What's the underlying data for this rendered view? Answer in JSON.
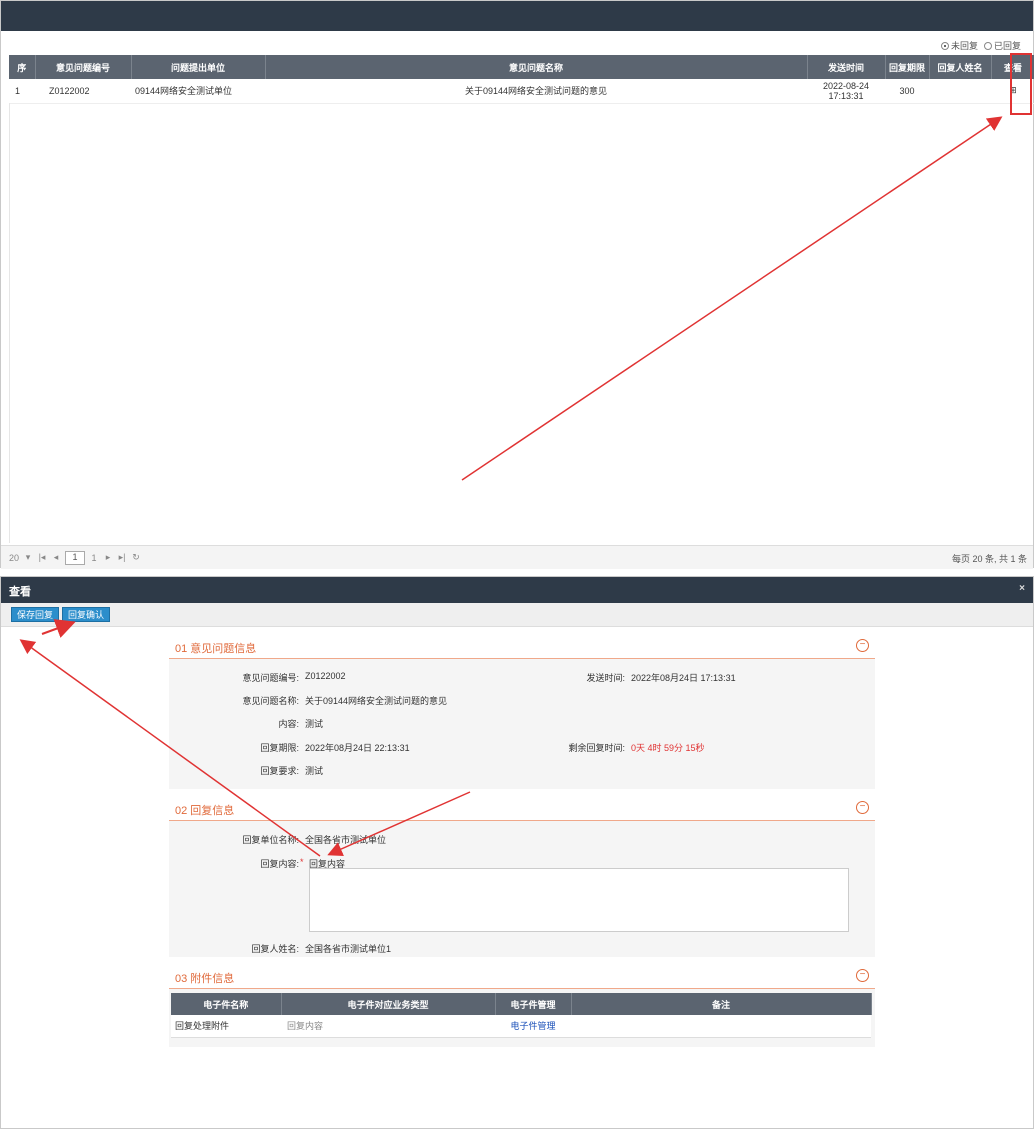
{
  "list_window": {
    "filter": {
      "options": [
        {
          "label": "未回复",
          "selected": true
        },
        {
          "label": "已回复",
          "selected": false
        }
      ]
    },
    "table": {
      "columns": [
        "序",
        "意见问题编号",
        "问题提出单位",
        "意见问题名称",
        "发送时间",
        "回复期限",
        "回复人姓名",
        "查看"
      ],
      "rows": [
        {
          "seq": "1",
          "id": "Z0122002",
          "unit": "09144网络安全测试单位",
          "name": "关于09144网络安全测试问题的意见",
          "time": "2022-08-24 17:13:31",
          "deadline": "300",
          "replier": "",
          "view": "⊞"
        }
      ]
    },
    "pager": {
      "page_size": "20",
      "page": "1",
      "total_pages": "1",
      "summary": "每页 20 条, 共 1 条"
    }
  },
  "detail_window": {
    "title": "查看",
    "close": "×",
    "toolbar": {
      "save_label": "保存回复",
      "confirm_label": "回复确认"
    },
    "section1": {
      "title": "01 意见问题信息",
      "id_label": "意见问题编号:",
      "id_value": "Z0122002",
      "send_label": "发送时间:",
      "send_value": "2022年08月24日 17:13:31",
      "name_label": "意见问题名称:",
      "name_value": "关于09144网络安全测试问题的意见",
      "content_label": "内容:",
      "content_value": "测试",
      "deadline_label": "回复期限:",
      "deadline_value": "2022年08月24日 22:13:31",
      "remaining_label": "剩余回复时间:",
      "remaining_value": "0天 4时 59分 15秒",
      "req_label": "回复要求:",
      "req_value": "测试"
    },
    "section2": {
      "title": "02 回复信息",
      "unit_label": "回复单位名称:",
      "unit_value": "全国各省市测试单位",
      "content_label": "回复内容:",
      "content_placeholder": "回复内容",
      "person_label": "回复人姓名:",
      "person_value": "全国各省市测试单位1"
    },
    "section3": {
      "title": "03 附件信息",
      "columns": [
        "电子件名称",
        "电子件对应业务类型",
        "电子件管理",
        "备注"
      ],
      "rows": [
        {
          "name": "回复处理附件",
          "type": "回复内容",
          "manage": "电子件管理",
          "note": ""
        }
      ]
    }
  },
  "colors": {
    "titlebar": "#2e3a48",
    "table_header": "#5b6470",
    "accent_orange": "#e06a3b",
    "button_blue": "#2c8ecb",
    "annotation_red": "#e03333"
  }
}
